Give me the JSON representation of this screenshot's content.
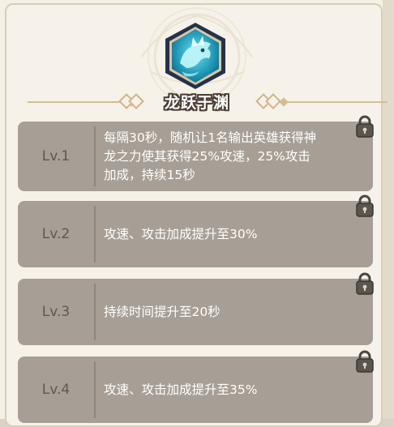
{
  "skill": {
    "title": "龙跃于渊",
    "icon": "dragon-emblem-icon"
  },
  "levels": [
    {
      "label": "Lv.1",
      "description": "每隔30秒，随机让1名输出英雄获得神\n龙之力使其获得25%攻速，25%攻击\n加成，持续15秒",
      "locked": true
    },
    {
      "label": "Lv.2",
      "description": "攻速、攻击加成提升至30%",
      "locked": true
    },
    {
      "label": "Lv.3",
      "description": "持续时间提升至20秒",
      "locked": true
    },
    {
      "label": "Lv.4",
      "description": "攻速、攻击加成提升至35%",
      "locked": true
    }
  ],
  "colors": {
    "panel_bg": "#f4f0e6",
    "row_bg": "#a79f95",
    "level_text": "#5e574f",
    "desc_text": "#ffffff",
    "accent_gold": "#d6bb93",
    "emblem_frame": "#2a3550",
    "emblem_fill": "#3cc3d6"
  }
}
